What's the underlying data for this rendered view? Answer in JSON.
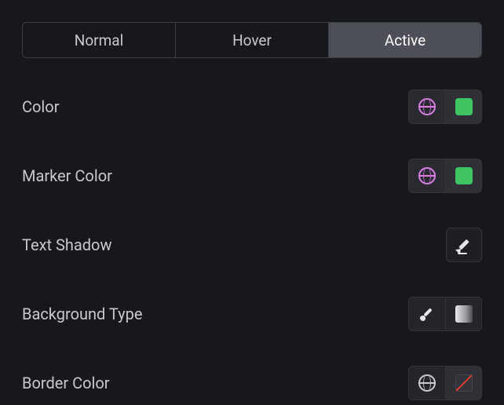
{
  "tabs": {
    "items": [
      {
        "label": "Normal",
        "active": false
      },
      {
        "label": "Hover",
        "active": false
      },
      {
        "label": "Active",
        "active": true
      }
    ]
  },
  "rows": {
    "color": {
      "label": "Color",
      "globe": "pink",
      "swatch": "#40c463"
    },
    "marker_color": {
      "label": "Marker Color",
      "globe": "pink",
      "swatch": "#40c463"
    },
    "text_shadow": {
      "label": "Text Shadow",
      "action_icon": "pencil"
    },
    "background_type": {
      "label": "Background Type",
      "icons": [
        "brush",
        "gradient"
      ]
    },
    "border_color": {
      "label": "Border Color",
      "globe": "grey",
      "swatch": "none"
    }
  },
  "colors": {
    "globe_active": "#d87fe8",
    "globe_default": "#c9cbd1",
    "swatch_green": "#40c463",
    "slash_red": "#e53935"
  }
}
